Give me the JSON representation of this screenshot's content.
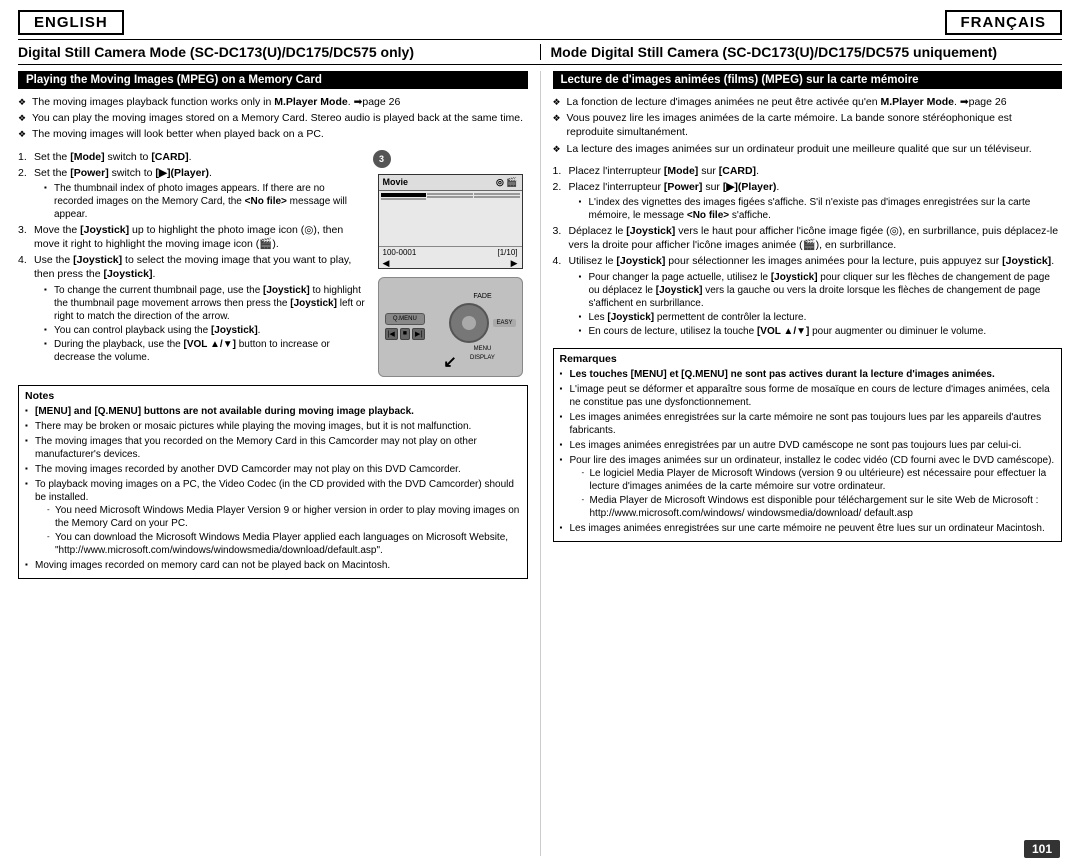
{
  "header": {
    "english_label": "ENGLISH",
    "francais_label": "FRANÇAIS"
  },
  "title": {
    "left": "Digital Still Camera Mode (SC-DC173(U)/DC175/DC575 only)",
    "right": "Mode Digital Still Camera (SC-DC173(U)/DC175/DC575 uniquement)"
  },
  "english": {
    "section_header": "Playing the Moving Images (MPEG) on a Memory Card",
    "bullets": [
      "The moving images playback function works only in M.Player Mode. ➡page 26",
      "You can play the moving images stored on a Memory Card. Stereo audio is played back at the same time.",
      "The moving images will look better when played back on a PC."
    ],
    "steps": [
      {
        "num": "1.",
        "text": "Set the [Mode] switch to [CARD]."
      },
      {
        "num": "2.",
        "text": "Set the [Power] switch to [▶](Player).",
        "sub": [
          "The thumbnail index of photo images appears. If there are no recorded images on the Memory Card, the <No file> message will appear."
        ]
      },
      {
        "num": "3.",
        "text": "Move the [Joystick] up to highlight the photo image icon (◎), then move it right to highlight the moving image icon (🎬)."
      },
      {
        "num": "4.",
        "text": "Use the [Joystick] to select the moving image that you want to play, then press the [Joystick].",
        "sub": [
          "To change the current thumbnail page, use the [Joystick] to highlight the thumbnail page movement arrows then press the [Joystick] left or right to match the direction of the arrow.",
          "You can control playback using the [Joystick].",
          "During the playback, use the [VOL ▲/▼] button to increase or decrease the volume."
        ]
      }
    ],
    "notes_title": "Notes",
    "notes": [
      "[MENU] and [Q.MENU] buttons are not available during moving image playback.",
      "There may be broken or mosaic pictures while playing the moving images, but it is not malfunction.",
      "The moving images that you recorded on the Memory Card in this Camcorder may not play on other manufacturer's devices.",
      "The moving images recorded by another DVD Camcorder may not play on this DVD Camcorder.",
      "To playback moving images on a PC, the Video Codec (in the CD provided with the DVD Camcorder) should be installed.",
      "You need Microsoft Windows Media Player Version 9 or higher version in order to play moving images on the Memory Card on your PC.",
      "You can download the Microsoft Windows Media Player applied each languages on Microsoft Website, \"http://www.microsoft.com/windows/windowsmedia/download/default.asp\".",
      "Moving images recorded on memory card can not be played back on Macintosh."
    ]
  },
  "francais": {
    "section_header": "Lecture de d'images animées (films) (MPEG) sur la carte mémoire",
    "bullets": [
      "La fonction de lecture d'images animées ne peut être activée qu'en M.Player Mode. ➡page 26",
      "Vous pouvez lire les images animées de la carte mémoire. La bande sonore stéréophonique est reproduite simultanément.",
      "La lecture des images animées sur un ordinateur produit une meilleure qualité que sur un téléviseur."
    ],
    "steps": [
      {
        "num": "1.",
        "text": "Placez l'interrupteur [Mode] sur [CARD]."
      },
      {
        "num": "2.",
        "text": "Placez l'interrupteur [Power] sur [▶](Player).",
        "sub": [
          "L'index des vignettes des images figées s'affiche. S'il n'existe pas d'images enregistrées sur la carte mémoire, le message <No file> s'affiche."
        ]
      },
      {
        "num": "3.",
        "text": "Déplacez le [Joystick] vers le haut pour afficher l'icône image figée (◎), en surbrillance, puis déplacez-le vers la droite pour afficher l'icône images animée (🎬), en surbrillance."
      },
      {
        "num": "4.",
        "text": "Utilisez le [Joystick] pour sélectionner les images animées pour la lecture, puis appuyez sur [Joystick].",
        "sub": [
          "Pour changer la page actuelle, utilisez le [Joystick] pour cliquer sur les flèches de changement de page ou déplacez le [Joystick] vers la gauche ou vers la droite lorsque les flèches de changement de page s'affichent en surbrillance.",
          "Les [Joystick] permettent de contrôler la lecture.",
          "En cours de lecture, utilisez la touche [VOL ▲/▼] pour augmenter ou diminuer le volume."
        ]
      }
    ],
    "remarques_title": "Remarques",
    "remarques": [
      "Les touches [MENU] et [Q.MENU] ne sont pas actives durant la lecture d'images animées.",
      "L'image peut se déformer et apparaître sous forme de mosaïque en cours de lecture d'images animées, cela ne constitue pas une dysfonctionnement.",
      "Les images animées enregistrées sur la carte mémoire ne sont pas toujours lues par les appareils d'autres fabricants.",
      "Les images animées enregistrées par un autre DVD caméscope ne sont pas toujours lues par celui-ci.",
      "Pour lire des images animées sur un ordinateur, installez le codec vidéo (CD fourni avec le DVD caméscope).",
      "Le logiciel Media Player de Microsoft Windows (version 9 ou ultérieure) est nécessaire pour effectuer la lecture d'images animées de la carte mémoire sur votre ordinateur.",
      "Media Player de Microsoft Windows est disponible pour téléchargement sur le site Web de Microsoft : http://www.microsoft.com/windows/ windowsmedia/download/ default.asp",
      "Les images animées enregistrées sur une carte mémoire ne peuvent être lues sur un ordinateur Macintosh."
    ]
  },
  "movie_screen": {
    "label": "Movie",
    "code": "100-0001",
    "page": "[1/10]"
  },
  "page_number": "101"
}
